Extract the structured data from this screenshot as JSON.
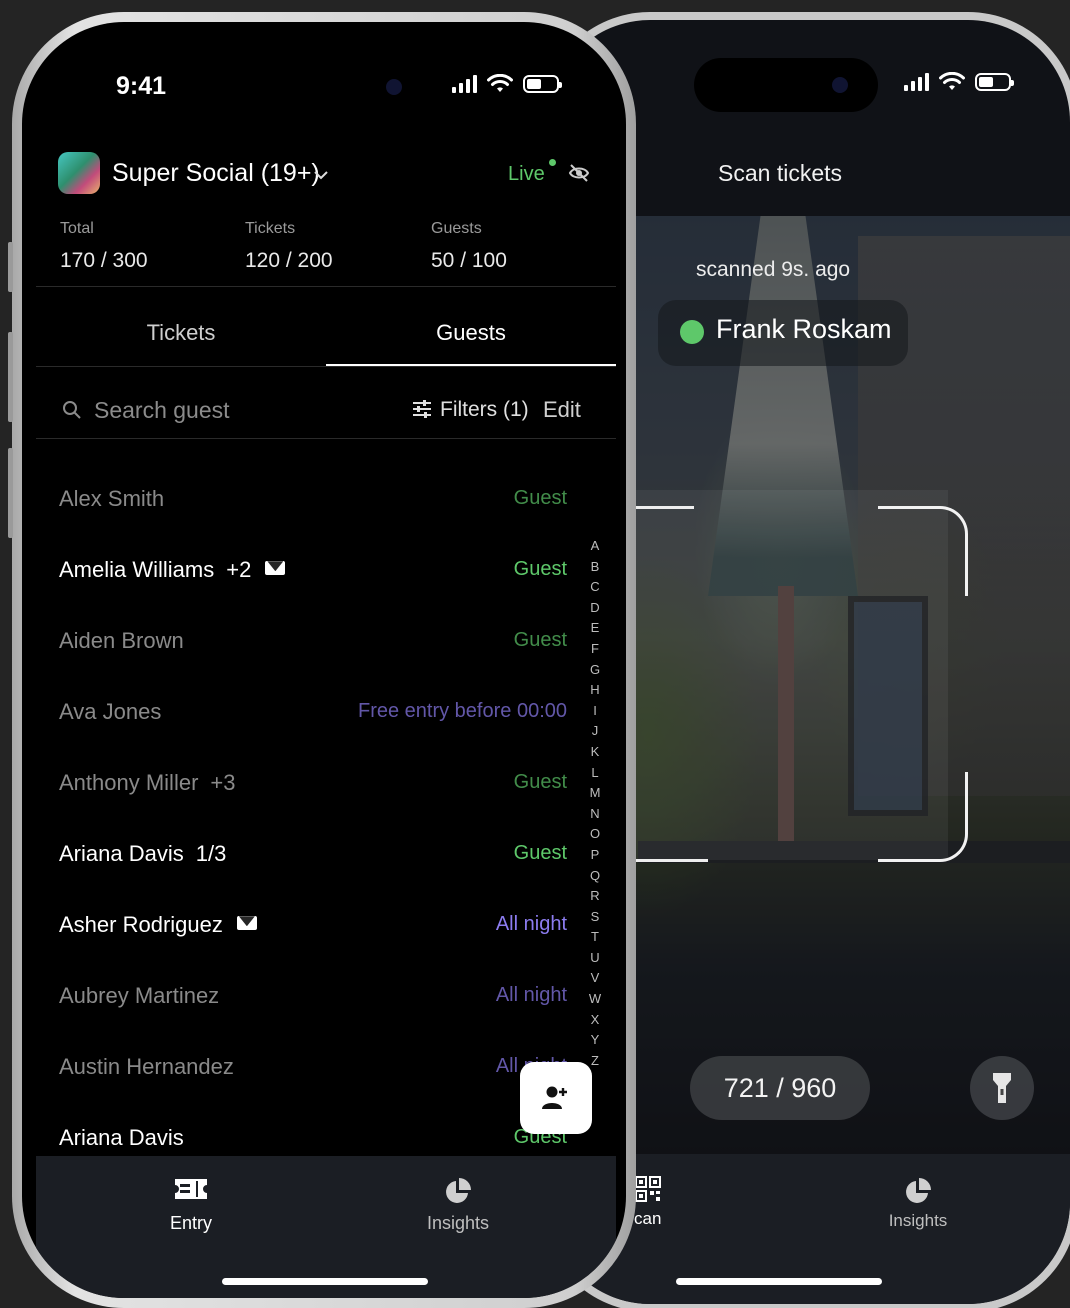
{
  "colors": {
    "background": "#242424",
    "live_green": "#5ec86a",
    "guest_green": "#5ec86a",
    "purple": "#8c7cf0",
    "status_dot": "#5ec86a"
  },
  "left_phone": {
    "status_time": "9:41",
    "event": {
      "title": "Super Social (19+)",
      "live_label": "Live"
    },
    "stats": [
      {
        "label": "Total",
        "value": "170 / 300"
      },
      {
        "label": "Tickets",
        "value": "120 / 200"
      },
      {
        "label": "Guests",
        "value": "50 / 100"
      }
    ],
    "tabs": [
      {
        "label": "Tickets",
        "active": false
      },
      {
        "label": "Guests",
        "active": true
      }
    ],
    "search": {
      "placeholder": "Search guest",
      "filters_label": "Filters (1)",
      "edit_label": "Edit"
    },
    "guests": [
      {
        "name": "Alex Smith",
        "extra": "",
        "mail": false,
        "type": "Guest",
        "type_color": "green",
        "dim": true
      },
      {
        "name": "Amelia Williams",
        "extra": "+2",
        "mail": true,
        "type": "Guest",
        "type_color": "green",
        "dim": false
      },
      {
        "name": "Aiden Brown",
        "extra": "",
        "mail": false,
        "type": "Guest",
        "type_color": "green",
        "dim": true
      },
      {
        "name": "Ava Jones",
        "extra": "",
        "mail": false,
        "type": "Free entry before 00:00",
        "type_color": "purple",
        "dim": true
      },
      {
        "name": "Anthony Miller",
        "extra": "+3",
        "mail": false,
        "type": "Guest",
        "type_color": "green",
        "dim": true
      },
      {
        "name": "Ariana Davis",
        "extra": "1/3",
        "mail": false,
        "type": "Guest",
        "type_color": "green",
        "dim": false
      },
      {
        "name": "Asher Rodriguez",
        "extra": "",
        "mail": true,
        "type": "All night",
        "type_color": "purple",
        "dim": false
      },
      {
        "name": "Aubrey Martinez",
        "extra": "",
        "mail": false,
        "type": "All night",
        "type_color": "purple",
        "dim": true
      },
      {
        "name": "Austin Hernandez",
        "extra": "",
        "mail": false,
        "type": "All night",
        "type_color": "purple",
        "dim": true
      },
      {
        "name": "Ariana Davis",
        "extra": "",
        "mail": false,
        "type": "Guest",
        "type_color": "green",
        "dim": false
      }
    ],
    "alphabet": [
      "A",
      "B",
      "C",
      "D",
      "E",
      "F",
      "G",
      "H",
      "I",
      "J",
      "K",
      "L",
      "M",
      "N",
      "O",
      "P",
      "Q",
      "R",
      "S",
      "T",
      "U",
      "V",
      "W",
      "X",
      "Y",
      "Z"
    ],
    "tabbar": [
      {
        "label": "Entry",
        "icon": "ticket-icon",
        "active": true
      },
      {
        "label": "Insights",
        "icon": "pie-chart-icon",
        "active": false
      }
    ]
  },
  "right_phone": {
    "header_title": "Scan tickets",
    "last_scan": "scanned 9s. ago",
    "scanned_name": "Frank Roskam",
    "counter": "721 / 960",
    "tabbar": [
      {
        "label": "can",
        "icon": "qr-code-icon"
      },
      {
        "label": "Insights",
        "icon": "pie-chart-icon"
      }
    ]
  }
}
